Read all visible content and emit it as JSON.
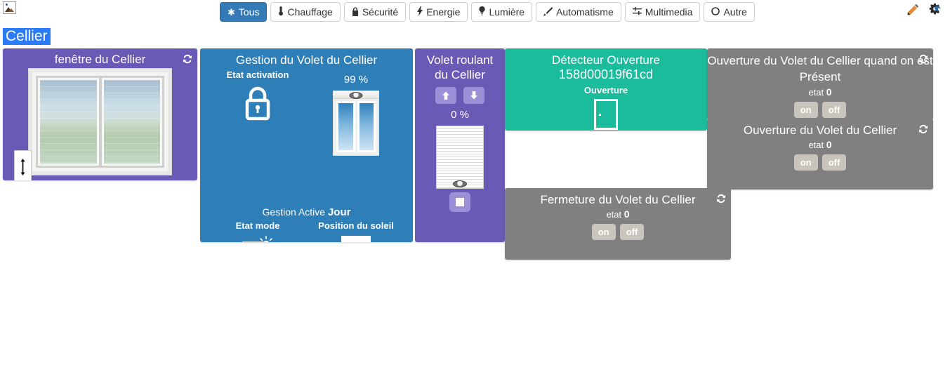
{
  "topbar": {
    "broken_image_icon": "broken-image-icon",
    "categories": [
      {
        "id": "tous",
        "label": "Tous",
        "icon": "asterisk-icon",
        "glyph": "✱",
        "active": true
      },
      {
        "id": "chauffage",
        "label": "Chauffage",
        "icon": "thermometer-icon",
        "glyph": "🌡",
        "active": false
      },
      {
        "id": "securite",
        "label": "Sécurité",
        "icon": "lock-icon",
        "glyph": "🔒",
        "active": false
      },
      {
        "id": "energie",
        "label": "Energie",
        "icon": "bolt-icon",
        "glyph": "⚡",
        "active": false
      },
      {
        "id": "lumiere",
        "label": "Lumière",
        "icon": "lightbulb-icon",
        "glyph": "💡",
        "active": false
      },
      {
        "id": "automatisme",
        "label": "Automatisme",
        "icon": "magic-wand-icon",
        "glyph": "✦",
        "active": false
      },
      {
        "id": "multimedia",
        "label": "Multimedia",
        "icon": "sliders-icon",
        "glyph": "☰",
        "active": false
      },
      {
        "id": "autre",
        "label": "Autre",
        "icon": "circle-icon",
        "glyph": "○",
        "active": false
      }
    ],
    "edit_icon": "pencil-icon",
    "settings_icon": "gears-icon"
  },
  "page": {
    "title": "Cellier",
    "title_highlight_color": "#2a7bf6"
  },
  "colors": {
    "purple": "#6b5ab5",
    "blue": "#2e7eb8",
    "green": "#1abc9c",
    "gray": "#808080",
    "button_purple": "#9c8fd8",
    "button_gray": "#c9c5bd",
    "active_tab": "#337ab7"
  },
  "cards": {
    "fenetre": {
      "title": "fenêtre du Cellier",
      "refresh_icon": "refresh-icon",
      "resize_icon": "vertical-resize-icon",
      "image_alt": "window-landscape-image"
    },
    "gestion": {
      "title": "Gestion du Volet du Cellier",
      "etat_activation_label": "Etat activation",
      "etat_activation_icon": "padlock-closed-icon",
      "percent": "99 %",
      "shutter_icon": "open-window-icon",
      "gestion_active_label": "Gestion Active",
      "gestion_active_value": "Jour",
      "etat_mode_label": "Etat mode",
      "etat_mode_icon": "shutter-sun-icon",
      "position_soleil_label": "Position du soleil",
      "position_soleil_icon": "open-blind-icon"
    },
    "volet": {
      "title_line1": "Volet roulant",
      "title_line2": "du Cellier",
      "up_icon": "arrow-up-icon",
      "down_icon": "arrow-down-icon",
      "percent": "0 %",
      "shutter_icon": "closed-shutter-icon",
      "stop_icon": "stop-square-icon"
    },
    "detecteur": {
      "title_line1": "Détecteur Ouverture",
      "title_line2": "158d00019f61cd",
      "state_label": "Ouverture",
      "state_icon": "open-door-icon"
    },
    "scenarios": [
      {
        "title": "Ouverture du Volet du Cellier quand on est Présent",
        "state_label": "etat",
        "state_value": "0",
        "on_label": "on",
        "off_label": "off",
        "refresh_icon": "refresh-icon"
      },
      {
        "title": "Ouverture du Volet du Cellier",
        "state_label": "etat",
        "state_value": "0",
        "on_label": "on",
        "off_label": "off",
        "refresh_icon": "refresh-icon"
      },
      {
        "title": "Fermeture du Volet du Cellier",
        "state_label": "etat",
        "state_value": "0",
        "on_label": "on",
        "off_label": "off",
        "refresh_icon": "refresh-icon"
      }
    ]
  }
}
